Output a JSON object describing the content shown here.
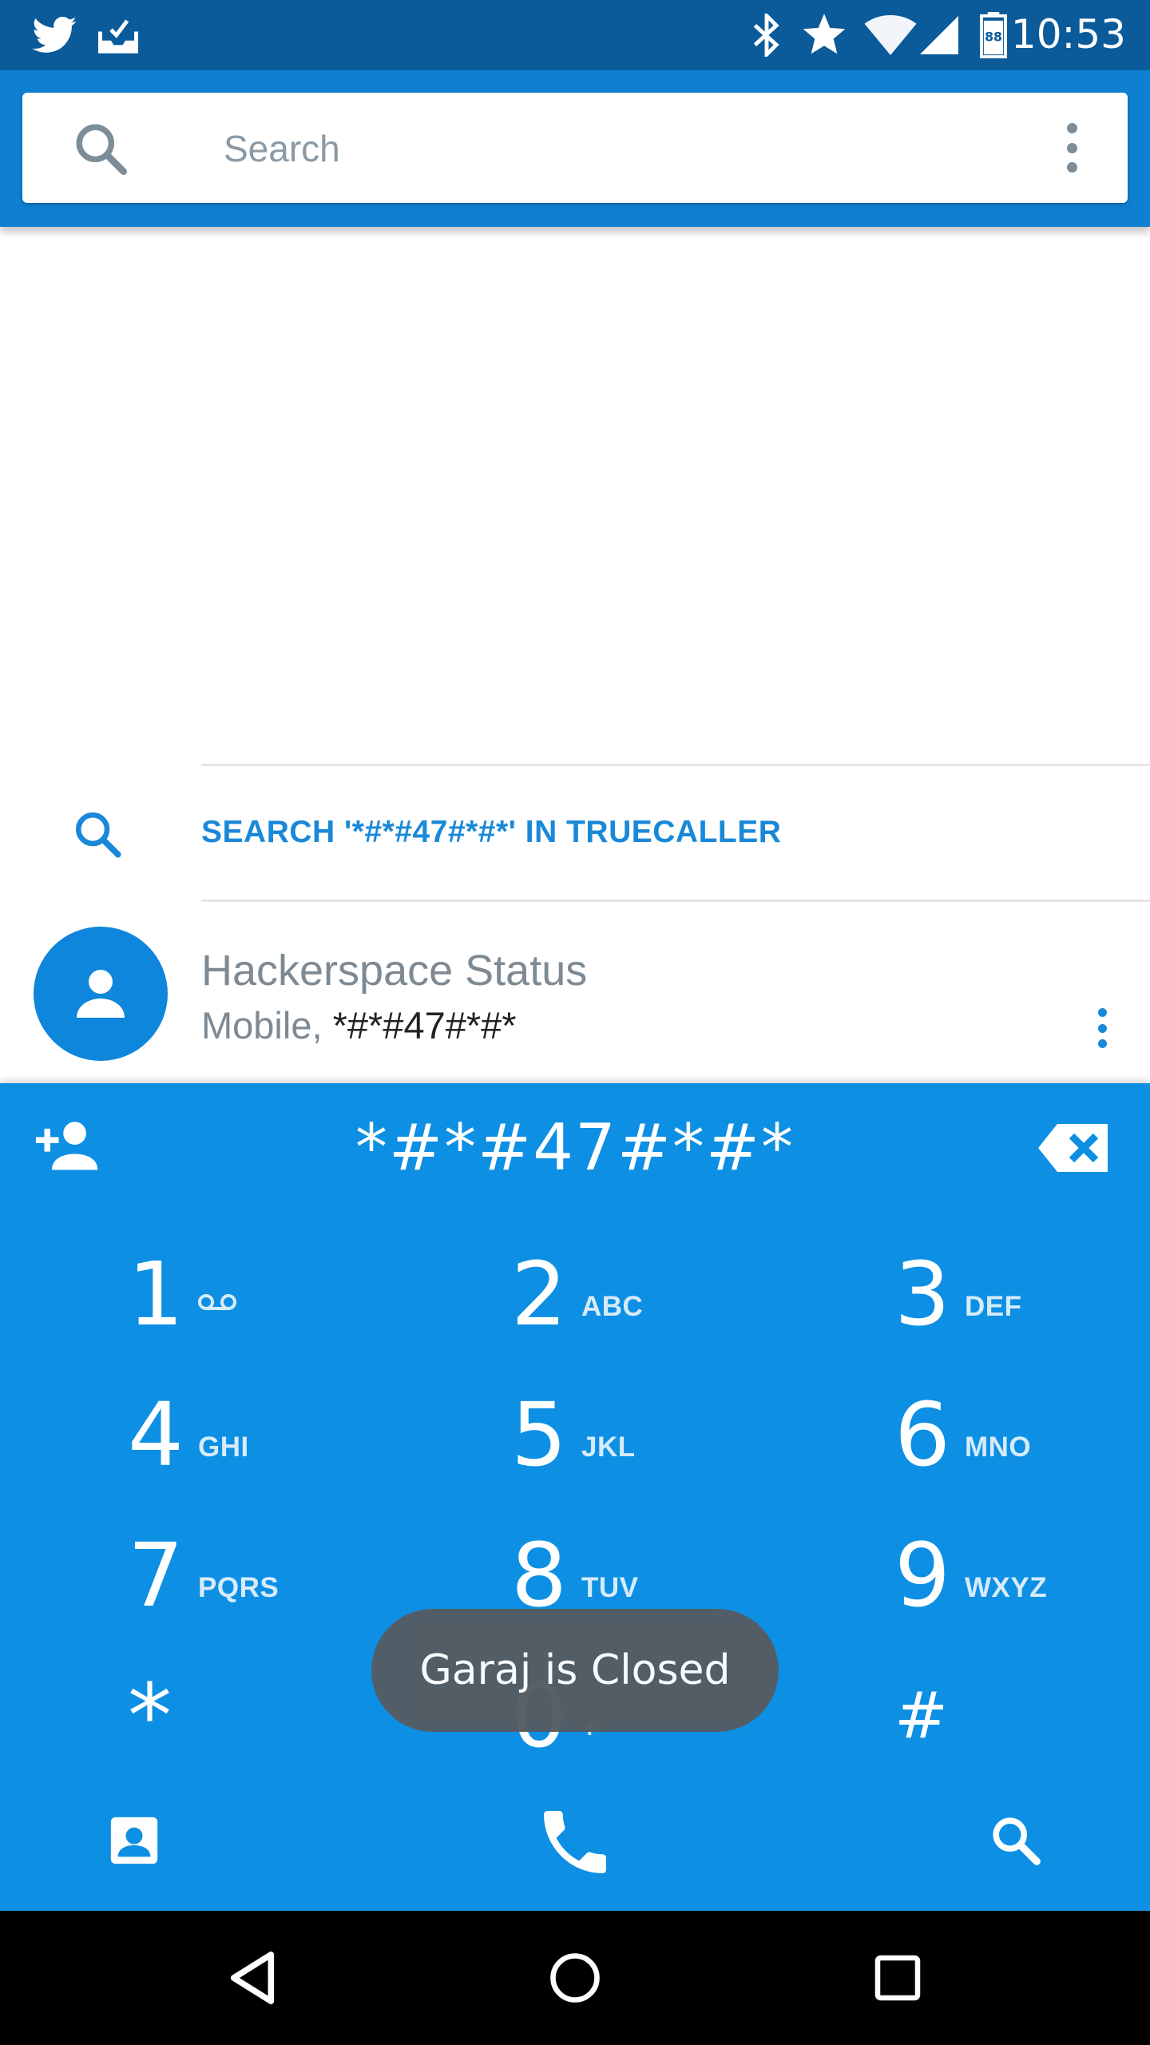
{
  "status_bar": {
    "time": "10:53",
    "left_icons": [
      "twitter-icon",
      "inbox-icon"
    ],
    "right_icons": [
      "bluetooth-icon",
      "star-icon",
      "wifi-icon",
      "cell-signal-icon",
      "battery-icon"
    ],
    "battery_level": "88",
    "color": "#0b5b9a"
  },
  "search": {
    "placeholder": "Search"
  },
  "results": {
    "truecaller_action": "SEARCH '*#*#47#*#*' IN TRUECALLER",
    "contact": {
      "name": "Hackerspace Status",
      "type": "Mobile, ",
      "number": "*#*#47#*#*"
    }
  },
  "dialpad": {
    "entered_digits": "*#*#47#*#*",
    "keys": [
      {
        "num": "1",
        "letters": ""
      },
      {
        "num": "2",
        "letters": "ABC"
      },
      {
        "num": "3",
        "letters": "DEF"
      },
      {
        "num": "4",
        "letters": "GHI"
      },
      {
        "num": "5",
        "letters": "JKL"
      },
      {
        "num": "6",
        "letters": "MNO"
      },
      {
        "num": "7",
        "letters": "PQRS"
      },
      {
        "num": "8",
        "letters": "TUV"
      },
      {
        "num": "9",
        "letters": "WXYZ"
      },
      {
        "num": "*",
        "letters": ""
      },
      {
        "num": "0",
        "letters": "+"
      },
      {
        "num": "#",
        "letters": ""
      }
    ],
    "color": "#0d8fe4"
  },
  "toast": {
    "message": "Garaj is Closed"
  },
  "accent": "#1a88d8"
}
